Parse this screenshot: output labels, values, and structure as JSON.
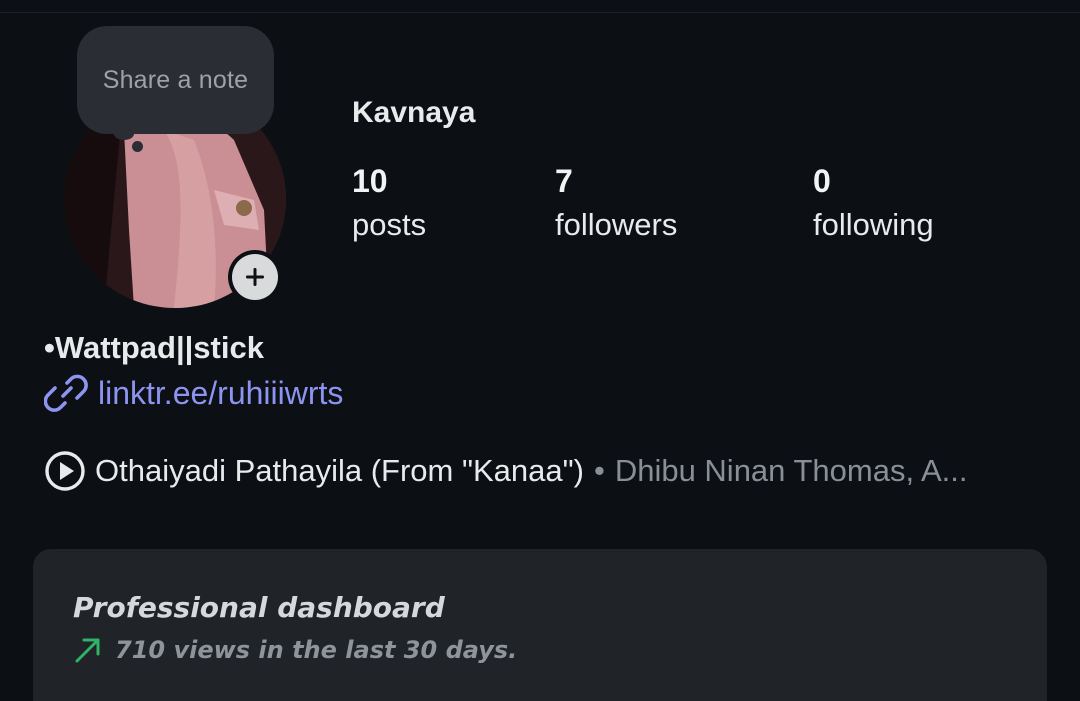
{
  "profile": {
    "username": "Kavnaya",
    "note_placeholder": "Share a note",
    "avatar_icon": "profile-photo",
    "add_story_icon": "plus-icon"
  },
  "stats": [
    {
      "value": "10",
      "label": "posts"
    },
    {
      "value": "7",
      "label": "followers"
    },
    {
      "value": "0",
      "label": "following"
    }
  ],
  "bio": {
    "name": "•Wattpad||stick",
    "link": "linktr.ee/ruhiiiwrts",
    "link_icon": "link-icon"
  },
  "music": {
    "icon": "play-circle-icon",
    "title": "Othaiyadi Pathayila (From \"Kanaa\")",
    "separator": "•",
    "artist": "Dhibu Ninan Thomas, A..."
  },
  "dashboard": {
    "title": "Professional dashboard",
    "subtitle": "710 views in the last 30 days.",
    "trend_icon": "trend-up-arrow-icon",
    "trend_color": "#2fb367"
  },
  "colors": {
    "background": "#0c0f14",
    "link": "#8d94f0",
    "card": "#202327"
  }
}
